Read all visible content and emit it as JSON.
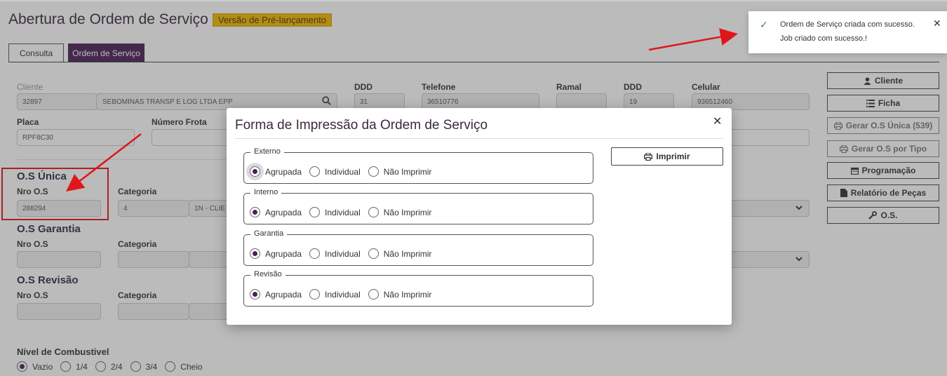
{
  "header": {
    "title": "Abertura de Ordem de Serviço",
    "badge": "Versão de Pré-lançamento"
  },
  "tabs": [
    {
      "label": "Consulta"
    },
    {
      "label": "Ordem de Serviço"
    }
  ],
  "form": {
    "cliente": {
      "label": "Cliente",
      "code": "32897",
      "name": "SEBOMINAS TRANSP E LOG LTDA EPP"
    },
    "ddd1": {
      "label": "DDD",
      "value": "31"
    },
    "telefone": {
      "label": "Telefone",
      "value": "36510776"
    },
    "ramal": {
      "label": "Ramal",
      "value": ""
    },
    "ddd2": {
      "label": "DDD",
      "value": "19"
    },
    "celular": {
      "label": "Celular",
      "value": "936512460"
    },
    "placa": {
      "label": "Placa",
      "value": "RPF8C30"
    },
    "numero_frota": {
      "label": "Número Frota"
    },
    "os_unica": {
      "title": "O.S Única",
      "nro_label": "Nro O.S",
      "nro": "288294",
      "cat_label": "Categoria",
      "cat_code": "4",
      "cat_name": "1N - CLIE"
    },
    "os_garantia": {
      "title": "O.S Garantia",
      "nro_label": "Nro O.S",
      "cat_label": "Categoria"
    },
    "os_revisao": {
      "title": "O.S Revisão",
      "nro_label": "Nro O.S",
      "cat_label": "Categoria"
    },
    "combustivel": {
      "label": "Nível de Combustivel",
      "options": [
        "Vazio",
        "1/4",
        "2/4",
        "3/4",
        "Cheio"
      ]
    }
  },
  "side_buttons": {
    "cliente": "Cliente",
    "ficha": "Ficha",
    "gerar_unica": "Gerar O.S Única (539)",
    "gerar_tipo": "Gerar O.S por Tipo",
    "programacao": "Programação",
    "relatorio": "Relatório de Peças",
    "os": "O.S."
  },
  "modal": {
    "title": "Forma de Impressão da Ordem de Serviço",
    "print_button": "Imprimir",
    "groups": [
      {
        "legend": "Externo",
        "selected": "Agrupada"
      },
      {
        "legend": "Interno",
        "selected": "Agrupada"
      },
      {
        "legend": "Garantia",
        "selected": "Agrupada"
      },
      {
        "legend": "Revisão",
        "selected": "Agrupada"
      }
    ],
    "options": [
      "Agrupada",
      "Individual",
      "Não Imprimir"
    ]
  },
  "toast": {
    "line1": "Ordem de Serviço criada com sucesso.",
    "line2": "Job criado com sucesso.!"
  },
  "colors": {
    "accent": "#4a1f56",
    "badge": "#f2b705",
    "annotation": "#e0161b"
  },
  "icons": [
    "search-icon",
    "user-icon",
    "list-icon",
    "printer-icon",
    "calendar-icon",
    "document-icon",
    "wrench-icon",
    "chevron-down-icon",
    "check-icon",
    "close-icon",
    "arrow-annotation-icon"
  ]
}
